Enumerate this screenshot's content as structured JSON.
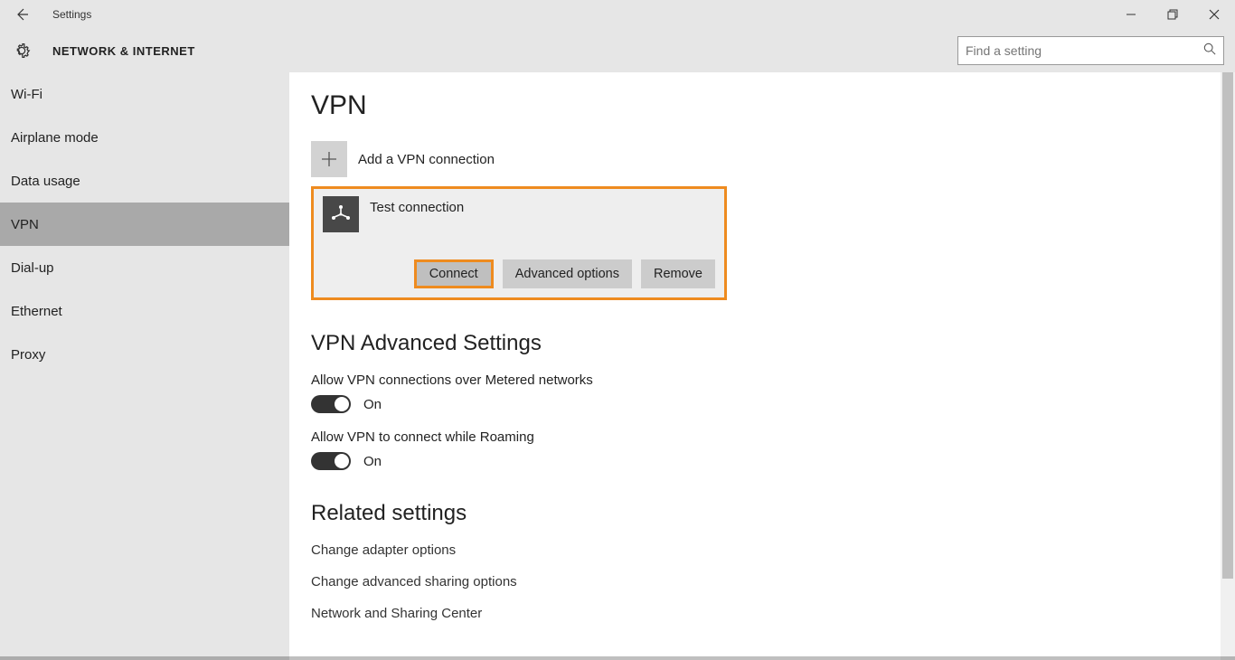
{
  "titlebar": {
    "title": "Settings"
  },
  "header": {
    "caption": "NETWORK & INTERNET",
    "search_placeholder": "Find a setting"
  },
  "sidebar": {
    "items": [
      {
        "label": "Wi-Fi",
        "selected": false
      },
      {
        "label": "Airplane mode",
        "selected": false
      },
      {
        "label": "Data usage",
        "selected": false
      },
      {
        "label": "VPN",
        "selected": true
      },
      {
        "label": "Dial-up",
        "selected": false
      },
      {
        "label": "Ethernet",
        "selected": false
      },
      {
        "label": "Proxy",
        "selected": false
      }
    ]
  },
  "content": {
    "page_title": "VPN",
    "add_label": "Add a VPN connection",
    "connection": {
      "name": "Test connection",
      "connect_label": "Connect",
      "advanced_label": "Advanced options",
      "remove_label": "Remove"
    },
    "advanced_heading": "VPN Advanced Settings",
    "metered": {
      "label": "Allow VPN connections over Metered networks",
      "state": "On"
    },
    "roaming": {
      "label": "Allow VPN to connect while Roaming",
      "state": "On"
    },
    "related_heading": "Related settings",
    "related_links": [
      "Change adapter options",
      "Change advanced sharing options",
      "Network and Sharing Center"
    ]
  },
  "colors": {
    "highlight": "#ee8b1f"
  }
}
